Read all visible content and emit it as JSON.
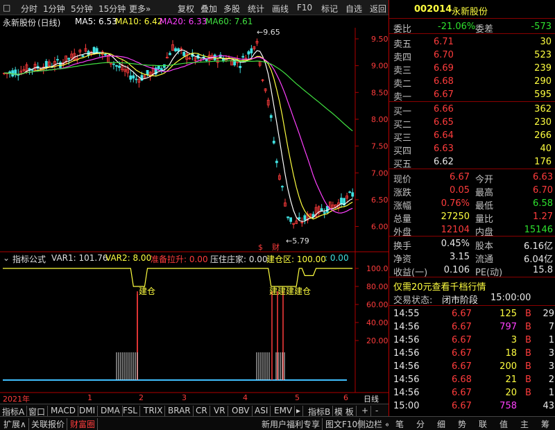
{
  "toolbar": {
    "left": [
      "分时",
      "1分钟",
      "5分钟",
      "15分钟",
      "更多»"
    ],
    "right": [
      "复权",
      "叠加",
      "多股",
      "统计",
      "画线",
      "F10",
      "标记",
      "自选",
      "返回"
    ]
  },
  "stock": {
    "name": "永新股份",
    "period": "(日线)",
    "code": "002014",
    "name_right": "永新股份"
  },
  "ma": [
    {
      "label": "MA5: 6.53",
      "color": "#ffffff"
    },
    {
      "label": "MA10: 6.42",
      "color": "#ffff40"
    },
    {
      "label": "MA20: 6.33",
      "color": "#ff40ff"
    },
    {
      "label": "MA60: 7.61",
      "color": "#40e040"
    }
  ],
  "price_axis": [
    "9.50",
    "9.00",
    "8.50",
    "8.00",
    "7.50",
    "7.00",
    "6.50",
    "6.00"
  ],
  "annotations": {
    "high": "9.65",
    "low": "5.79"
  },
  "indicator": {
    "name": "指标公式",
    "var1": "VAR1: 101.76",
    "var2": "VAR2: 8.00",
    "zbls": "准备拉升: 0.00",
    "yzz": "压住庄家: 0.00",
    "jcq": "建仓区: 100.00",
    "tail": ": 0.00",
    "axis": [
      "100.0",
      "80.00",
      "60.00",
      "40.00",
      "20.00"
    ],
    "labels": [
      "建仓",
      "建建建建仓"
    ]
  },
  "xaxis": {
    "year": "2021年",
    "months": [
      "1",
      "2",
      "3",
      "4",
      "5",
      "6"
    ],
    "period": "日线"
  },
  "tabs1": [
    "指标A",
    "窗口",
    "MACD",
    "DMI",
    "DMA",
    "FSL",
    "TRIX",
    "BRAR",
    "CR",
    "VR",
    "OBV",
    "ASI",
    "EMV",
    "▸",
    "指标B",
    "模 板",
    "+",
    "-"
  ],
  "tabs2": [
    "扩展∧",
    "关联报价",
    "财富圈",
    "新用户福利专享",
    "图文F10",
    "侧边栏 «"
  ],
  "quote": {
    "weibi_label": "委比",
    "weibi": "-21.06%",
    "weicha_label": "委差",
    "weicha": "-573",
    "asks": [
      {
        "label": "卖五",
        "price": "6.71",
        "vol": "30"
      },
      {
        "label": "卖四",
        "price": "6.70",
        "vol": "523"
      },
      {
        "label": "卖三",
        "price": "6.69",
        "vol": "239"
      },
      {
        "label": "卖二",
        "price": "6.68",
        "vol": "290"
      },
      {
        "label": "卖一",
        "price": "6.67",
        "vol": "595"
      }
    ],
    "bids": [
      {
        "label": "买一",
        "price": "6.66",
        "vol": "362"
      },
      {
        "label": "买二",
        "price": "6.65",
        "vol": "230"
      },
      {
        "label": "买三",
        "price": "6.64",
        "vol": "266"
      },
      {
        "label": "买四",
        "price": "6.63",
        "vol": "40"
      },
      {
        "label": "买五",
        "price": "6.62",
        "vol": "176"
      }
    ],
    "stats": [
      {
        "l1": "现价",
        "v1": "6.67",
        "l2": "今开",
        "v2": "6.63"
      },
      {
        "l1": "涨跌",
        "v1": "0.05",
        "l2": "最高",
        "v2": "6.70"
      },
      {
        "l1": "涨幅",
        "v1": "0.76%",
        "l2": "最低",
        "v2": "6.58"
      },
      {
        "l1": "总量",
        "v1": "27250",
        "l2": "量比",
        "v2": "1.27"
      },
      {
        "l1": "外盘",
        "v1": "12104",
        "l2": "内盘",
        "v2": "15146"
      }
    ],
    "stats2": [
      {
        "l1": "换手",
        "v1": "0.45%",
        "l2": "股本",
        "v2": "6.16亿"
      },
      {
        "l1": "净资",
        "v1": "3.15",
        "l2": "流通",
        "v2": "6.04亿"
      },
      {
        "l1": "收益(一)",
        "v1": "0.106",
        "l2": "PE(动)",
        "v2": "15.8"
      }
    ],
    "promo": "仅需20元查看千档行情",
    "status_label": "交易状态:",
    "status": "闭市阶段",
    "status_time": "15:00:00",
    "ticks": [
      {
        "time": "14:55",
        "price": "6.67",
        "vol": "125",
        "bs": "B",
        "n": "29"
      },
      {
        "time": "14:56",
        "price": "6.67",
        "vol": "797",
        "bs": "B",
        "n": "7"
      },
      {
        "time": "14:56",
        "price": "6.67",
        "vol": "3",
        "bs": "B",
        "n": "1"
      },
      {
        "time": "14:56",
        "price": "6.67",
        "vol": "18",
        "bs": "B",
        "n": "3"
      },
      {
        "time": "14:56",
        "price": "6.67",
        "vol": "200",
        "bs": "B",
        "n": "3"
      },
      {
        "time": "14:56",
        "price": "6.68",
        "vol": "21",
        "bs": "B",
        "n": "2"
      },
      {
        "time": "14:56",
        "price": "6.67",
        "vol": "20",
        "bs": "B",
        "n": "1"
      },
      {
        "time": "15:00",
        "price": "6.67",
        "vol": "758",
        "bs": "",
        "n": "43"
      }
    ],
    "bottom_tabs": [
      "笔",
      "分",
      "细",
      "势",
      "联",
      "值",
      "主",
      "筹"
    ]
  },
  "colors": {
    "up": "#ff3c3c",
    "down": "#2ee02e",
    "bg": "#000000",
    "border": "#b00000"
  }
}
